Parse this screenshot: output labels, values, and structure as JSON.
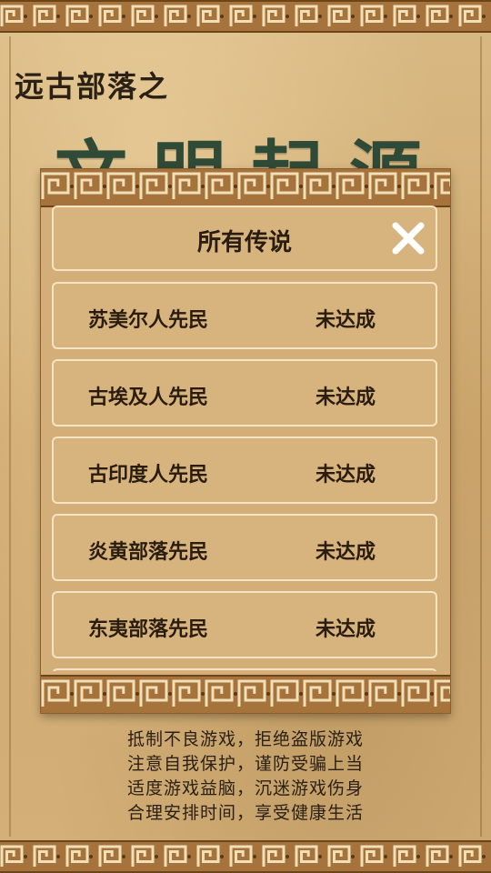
{
  "title": {
    "subtitle": "远古部落之",
    "main": "文明起源"
  },
  "modal": {
    "title": "所有传说",
    "close_icon": "close-icon",
    "rows": [
      {
        "name": "苏美尔人先民",
        "status": "未达成"
      },
      {
        "name": "古埃及人先民",
        "status": "未达成"
      },
      {
        "name": "古印度人先民",
        "status": "未达成"
      },
      {
        "name": "炎黄部落先民",
        "status": "未达成"
      },
      {
        "name": "东夷部落先民",
        "status": "未达成"
      },
      {
        "name": "",
        "status": ""
      }
    ]
  },
  "notice": {
    "lines": [
      "抵制不良游戏，拒绝盗版游戏",
      "注意自我保护，谨防受骗上当",
      "适度游戏益脑，沉迷游戏伤身",
      "合理安排时间，享受健康生活"
    ]
  },
  "colors": {
    "parchment": "#d6b47e",
    "border_band": "#a7733c",
    "text_dark": "#2a1d10",
    "title_green": "#2f4a36"
  }
}
